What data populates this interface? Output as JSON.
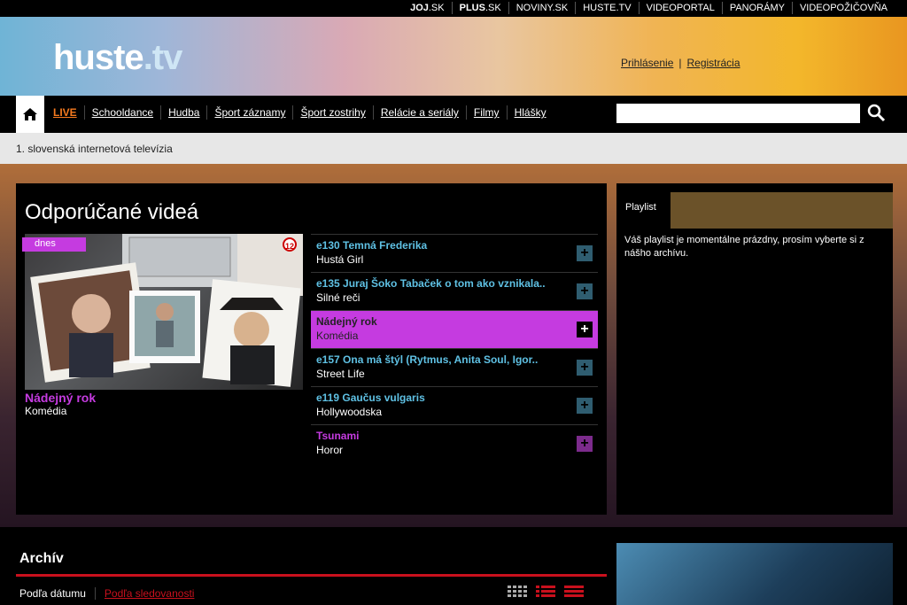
{
  "top_links": [
    {
      "label": "JOJ",
      "suffix": ".SK"
    },
    {
      "label": "PLUS",
      "suffix": ".SK"
    },
    {
      "label": "NOVINY.SK",
      "suffix": ""
    },
    {
      "label": "HUSTE.TV",
      "suffix": ""
    },
    {
      "label": "VIDEOPORTAL",
      "suffix": ""
    },
    {
      "label": "PANORÁMY",
      "suffix": ""
    },
    {
      "label": "VIDEOPOŽIČOVŇA",
      "suffix": ""
    }
  ],
  "logo": {
    "part1": "huste",
    "part2": ".tv"
  },
  "auth": {
    "login": "Prihlásenie",
    "register": "Registrácia"
  },
  "nav": {
    "items": [
      "LIVE",
      "Schooldance",
      "Hudba",
      "Šport záznamy",
      "Šport zostrihy",
      "Relácie a seriály",
      "Filmy",
      "Hlášky"
    ]
  },
  "subtitle": "1. slovenská internetová televízia",
  "featured": {
    "heading": "Odporúčané videá",
    "badge": "dnes",
    "age": "12",
    "title": "Nádejný rok",
    "genre": "Komédia"
  },
  "videos": [
    {
      "title": "e130 Temná Frederika",
      "show": "Hustá Girl",
      "state": "normal"
    },
    {
      "title": "e135 Juraj Šoko Tabaček o tom ako vznikala..",
      "show": "Silné reči",
      "state": "normal"
    },
    {
      "title": "Nádejný rok",
      "show": "Komédia",
      "state": "active"
    },
    {
      "title": "e157 Ona má štýl (Rytmus, Anita Soul, Igor..",
      "show": "Street Life",
      "state": "normal"
    },
    {
      "title": "e119 Gaučus vulgaris",
      "show": "Hollywoodska",
      "state": "normal"
    },
    {
      "title": "Tsunami",
      "show": "Horor",
      "state": "purple"
    }
  ],
  "playlist": {
    "tab": "Playlist",
    "text": "Váš playlist je momentálne prázdny, prosím vyberte si z nášho archívu."
  },
  "archive": {
    "title": "Archív",
    "sort_date": "Podľa dátumu",
    "sort_views": "Podľa sledovanosti"
  },
  "colors": {
    "accent_purple": "#c53be0",
    "live_orange": "#f57a1f",
    "archive_red": "#c9101d"
  }
}
